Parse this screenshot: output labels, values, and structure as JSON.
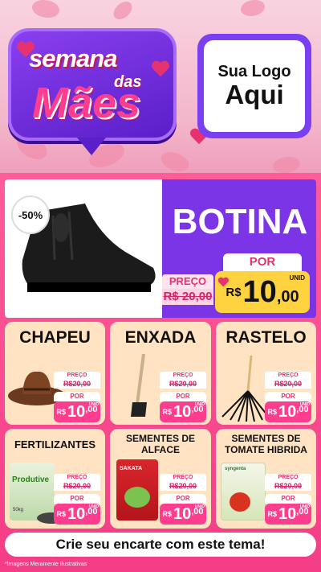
{
  "header": {
    "brand_line1": "semana",
    "brand_line2_small": "das",
    "brand_line2": "Mães",
    "logo_line1": "Sua Logo",
    "logo_line2": "Aqui"
  },
  "hero": {
    "discount_badge": "-50%",
    "title": "BOTINA",
    "price_label": "PREÇO",
    "old_price": "R$ 20,00",
    "por_label": "POR",
    "currency": "R$",
    "new_price_int": "10",
    "new_price_dec": ",00",
    "unit": "UNID"
  },
  "products": [
    {
      "title": "CHAPEU",
      "price_label": "PREÇO",
      "old_price": "R$20,00",
      "por_label": "POR",
      "currency": "R$",
      "new_price_int": "10",
      "new_price_dec": ",00",
      "unit": "UNID"
    },
    {
      "title": "ENXADA",
      "price_label": "PREÇO",
      "old_price": "R$20,00",
      "por_label": "POR",
      "currency": "R$",
      "new_price_int": "10",
      "new_price_dec": ",00",
      "unit": "UNID"
    },
    {
      "title": "RASTELO",
      "price_label": "PREÇO",
      "old_price": "R$20,00",
      "por_label": "POR",
      "currency": "R$",
      "new_price_int": "10",
      "new_price_dec": ",00",
      "unit": "UNID"
    },
    {
      "title": "FERTILIZANTES",
      "price_label": "PREÇO",
      "old_price": "R$20,00",
      "por_label": "POR",
      "currency": "R$",
      "new_price_int": "10",
      "new_price_dec": ",00",
      "unit": "UNID",
      "pack_brand": "Produtive",
      "pack_weight": "50kg"
    },
    {
      "title": "SEMENTES DE ALFACE",
      "price_label": "PREÇO",
      "old_price": "R$20,00",
      "por_label": "POR",
      "currency": "R$",
      "new_price_int": "10",
      "new_price_dec": ",00",
      "unit": "UNID",
      "pack_brand": "SAKATA"
    },
    {
      "title": "SEMENTES DE TOMATE HIBRIDA",
      "price_label": "PREÇO",
      "old_price": "R$20,00",
      "por_label": "POR",
      "currency": "R$",
      "new_price_int": "10",
      "new_price_dec": ",00",
      "unit": "UNID",
      "pack_brand": "syngenta"
    }
  ],
  "banner": "Crie seu encarte com este tema!",
  "disclaimer": "*Imagens Meramente Ilustrativas",
  "colors": {
    "purple": "#7b35e6",
    "pink": "#ff3d8e",
    "yellow": "#ffd23f",
    "card": "#ffe3c2"
  }
}
